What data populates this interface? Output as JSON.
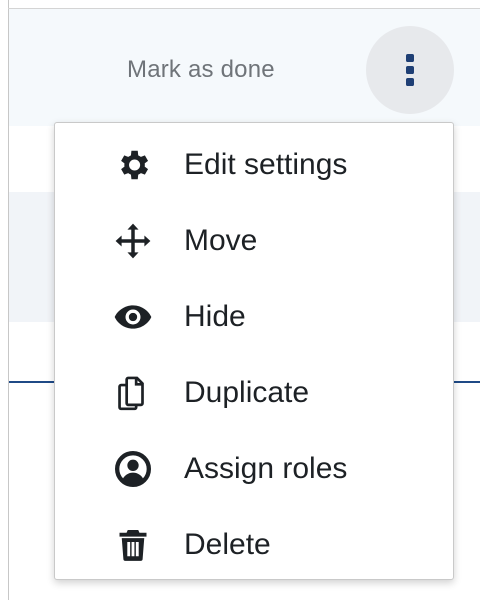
{
  "header": {
    "mark_done_label": "Mark as done",
    "actions_icon": "kebab-vertical-icon"
  },
  "menu": {
    "items": [
      {
        "label": "Edit settings",
        "icon": "gear-icon"
      },
      {
        "label": "Move",
        "icon": "move-arrows-icon"
      },
      {
        "label": "Hide",
        "icon": "eye-icon"
      },
      {
        "label": "Duplicate",
        "icon": "copy-icon"
      },
      {
        "label": "Assign roles",
        "icon": "user-circle-icon"
      },
      {
        "label": "Delete",
        "icon": "trash-icon"
      }
    ]
  },
  "colors": {
    "menu_text": "#1d2125",
    "accent_line": "#1f4a86",
    "kebab_dots": "#1f3f75"
  }
}
